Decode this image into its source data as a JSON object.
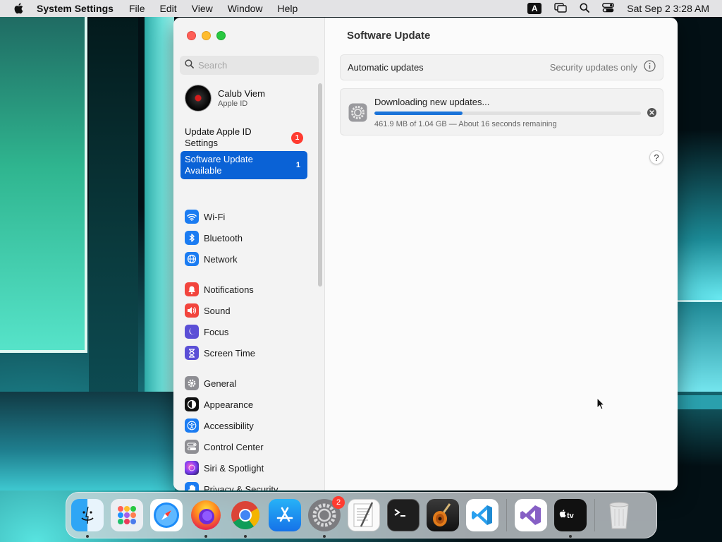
{
  "menubar": {
    "app_name": "System Settings",
    "menus": [
      "File",
      "Edit",
      "View",
      "Window",
      "Help"
    ],
    "input_source": "A",
    "clock": "Sat Sep 2  3:28 AM"
  },
  "sidebar": {
    "search_placeholder": "Search",
    "account": {
      "name": "Calub Viem",
      "subtitle": "Apple ID"
    },
    "alerts": [
      {
        "label": "Update Apple ID Settings",
        "badge": "1"
      },
      {
        "label": "Software Update Available",
        "badge": "1",
        "selected": true
      }
    ],
    "items": [
      {
        "label": "Wi-Fi",
        "icon": "wifi-icon",
        "color": "#1b7cf2"
      },
      {
        "label": "Bluetooth",
        "icon": "bluetooth-icon",
        "color": "#1b7cf2"
      },
      {
        "label": "Network",
        "icon": "globe-icon",
        "color": "#1b7cf2"
      },
      {
        "label": "Notifications",
        "icon": "bell-icon",
        "color": "#f2453d"
      },
      {
        "label": "Sound",
        "icon": "speaker-icon",
        "color": "#f2453d"
      },
      {
        "label": "Focus",
        "icon": "moon-icon",
        "color": "#5b4fd6"
      },
      {
        "label": "Screen Time",
        "icon": "hourglass-icon",
        "color": "#5b4fd6"
      },
      {
        "label": "General",
        "icon": "gear-icon",
        "color": "#8e8e93"
      },
      {
        "label": "Appearance",
        "icon": "appearance-icon",
        "color": "#111111"
      },
      {
        "label": "Accessibility",
        "icon": "accessibility-icon",
        "color": "#1b7cf2"
      },
      {
        "label": "Control Center",
        "icon": "control-center-icon",
        "color": "#8e8e93"
      },
      {
        "label": "Siri & Spotlight",
        "icon": "siri-icon",
        "color": "#7a3df0"
      },
      {
        "label": "Privacy & Security",
        "icon": "hand-icon",
        "color": "#1b7cf2"
      }
    ]
  },
  "main": {
    "title": "Software Update",
    "automatic_updates": {
      "label": "Automatic updates",
      "value": "Security updates only"
    },
    "download": {
      "title": "Downloading new updates...",
      "status": "461.9 MB of 1.04 GB — About 16 seconds remaining",
      "progress_percent": 33
    },
    "help_label": "?"
  },
  "dock": {
    "apps": [
      "Finder",
      "Launchpad",
      "Safari",
      "Firefox",
      "Chrome",
      "App Store",
      "System Settings",
      "TextEdit",
      "Terminal",
      "GarageBand",
      "Visual Studio Code",
      "Visual Studio",
      "Apple TV",
      "Trash"
    ],
    "system_settings_badge": "2"
  }
}
